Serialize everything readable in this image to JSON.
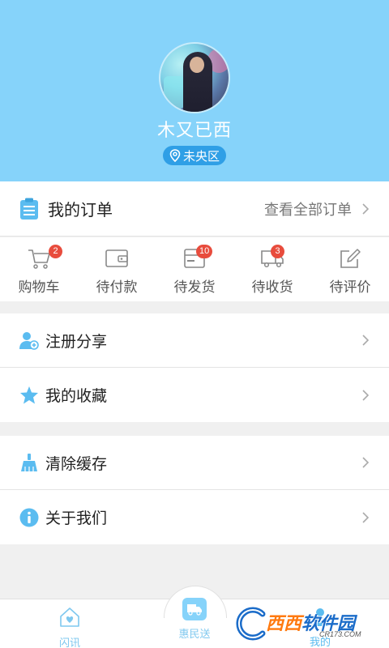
{
  "profile": {
    "username": "木又已西",
    "location": "未央区"
  },
  "orders": {
    "title": "我的订单",
    "view_all": "查看全部订单",
    "items": [
      {
        "label": "购物车",
        "badge": "2",
        "icon": "cart-icon"
      },
      {
        "label": "待付款",
        "badge": "",
        "icon": "wallet-icon"
      },
      {
        "label": "待发货",
        "badge": "10",
        "icon": "package-icon"
      },
      {
        "label": "待收货",
        "badge": "3",
        "icon": "truck-icon"
      },
      {
        "label": "待评价",
        "badge": "",
        "icon": "edit-icon"
      }
    ]
  },
  "menu_group_1": [
    {
      "label": "注册分享",
      "icon": "add-user-icon"
    },
    {
      "label": "我的收藏",
      "icon": "star-icon"
    }
  ],
  "menu_group_2": [
    {
      "label": "清除缓存",
      "icon": "broom-icon"
    },
    {
      "label": "关于我们",
      "icon": "info-icon"
    }
  ],
  "tabbar": {
    "tabs": [
      {
        "label": "闪讯",
        "icon": "home-heart-icon"
      },
      {
        "label": "惠民送",
        "icon": "delivery-truck-icon"
      },
      {
        "label": "我的",
        "icon": "person-icon"
      }
    ]
  },
  "watermark": {
    "brand_part1": "西西",
    "brand_part2": "软件园",
    "url": "CR173.COM"
  },
  "colors": {
    "header_bg": "#86d3fa",
    "badge": "#e84c3d",
    "accent": "#2f9fe6",
    "icon_blue": "#5bbcf0"
  }
}
